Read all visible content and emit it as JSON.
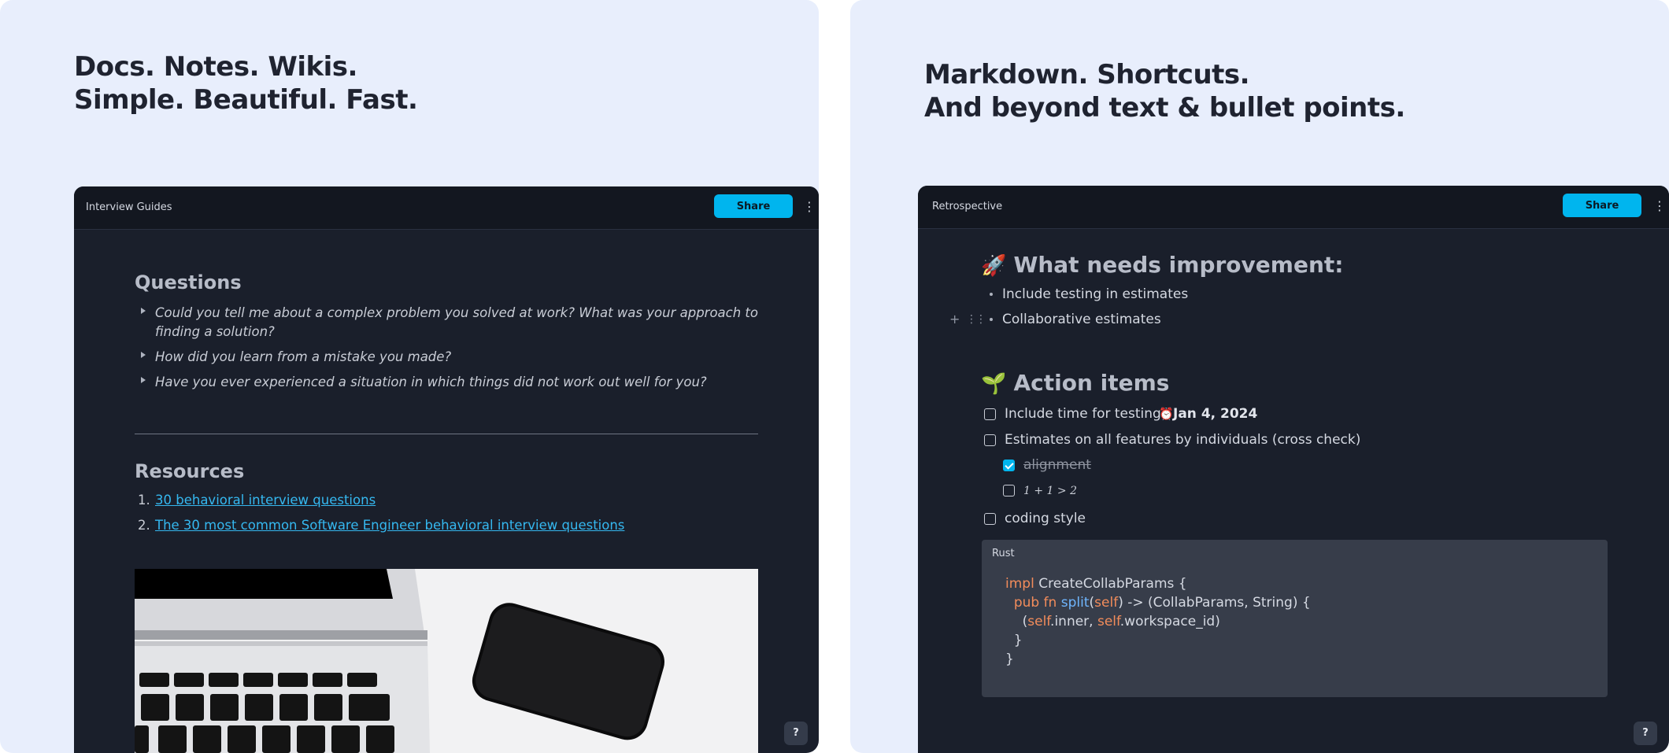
{
  "left_panel": {
    "headline": [
      "Docs. Notes. Wikis.",
      "Simple. Beautiful. Fast."
    ],
    "window": {
      "title": "Interview Guides",
      "share_label": "Share",
      "more_icon": "vertical-ellipsis-icon",
      "help_label": "?",
      "questions_heading": "Questions",
      "questions": [
        "Could you tell me about a complex problem you solved at work? What was your approach to finding a solution?",
        "How did you learn from a mistake you made?",
        "Have you ever experienced a situation in which things did not work out well for you?"
      ],
      "resources_heading": "Resources",
      "resources": [
        {
          "num": "1.",
          "text": "30 behavioral interview questions"
        },
        {
          "num": "2.",
          "text": "The 30 most common Software Engineer behavioral interview questions"
        }
      ],
      "image_semantic": "laptop-and-phone-photo"
    }
  },
  "right_panel": {
    "headline": [
      "Markdown. Shortcuts.",
      "And beyond text & bullet points."
    ],
    "window": {
      "title": "Retrospective",
      "share_label": "Share",
      "more_icon": "vertical-ellipsis-icon",
      "help_label": "?",
      "improvement_emoji": "🚀",
      "improvement_heading": "What needs improvement:",
      "improvement_items": [
        "Include testing in estimates",
        "Collaborative estimates"
      ],
      "action_emoji": "🌱",
      "action_heading": "Action items",
      "todos": {
        "t1": {
          "text": "Include time for testing",
          "checked": false,
          "date": "Jan 4, 2024"
        },
        "t2": {
          "text": "Estimates on all features by individuals (cross check)",
          "checked": false
        },
        "t3": {
          "text": "alignment",
          "checked": true
        },
        "t4": {
          "text": "1 + 1 > 2",
          "checked": false
        },
        "t5": {
          "text": "coding style",
          "checked": false
        }
      },
      "code": {
        "language": "Rust",
        "lines": [
          "impl CreateCollabParams {",
          "  pub fn split(self) -> (CollabParams, String) {",
          "    (self.inner, self.workspace_id)",
          "  }",
          "}"
        ]
      }
    }
  },
  "colors": {
    "panel_bg": "#e8eefc",
    "window_bg": "#1a1f2b",
    "topbar_bg": "#131720",
    "accent": "#00b5ee",
    "link": "#35b8f0",
    "code_keyword": "#f28c5b",
    "code_function": "#6fb6ff"
  }
}
